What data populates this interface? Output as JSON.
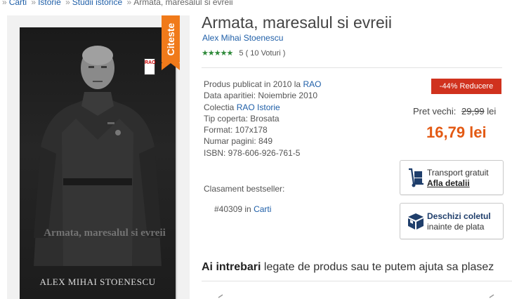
{
  "breadcrumb": {
    "items": [
      "Carti",
      "Istorie",
      "Studii istorice",
      "Armata, maresalul si evreii"
    ]
  },
  "cover": {
    "ribbon_label": "Citeste",
    "author_text": "ALEX MIHAI STOENESCU",
    "overlay_title": "Armata, maresalul si evreii",
    "publisher_mark": "RAO"
  },
  "product": {
    "title": "Armata, maresalul si evreii",
    "author": "Alex Mihai Stoenescu",
    "rating_stars": 5,
    "rating_value": "5",
    "rating_votes": "( 10 Voturi )"
  },
  "details": {
    "published_prefix": "Produs publicat in 2010 la ",
    "publisher": "RAO",
    "release_date": "Data aparitiei: Noiembrie 2010",
    "collection_prefix": "Colectia ",
    "collection": "RAO Istorie",
    "cover_type": "Tip coperta: Brosata",
    "format": "Format: 107x178",
    "pages": "Numar pagini: 849",
    "isbn": "ISBN: 978-606-926-761-5"
  },
  "bestseller": {
    "label": "Clasament bestseller:",
    "rank": "#40309 in ",
    "category": "Carti"
  },
  "price": {
    "discount_badge": "-44% Reducere",
    "old_label": "Pret vechi:",
    "old_value": "29,99",
    "old_currency": "lei",
    "new_value": "16,79 lei"
  },
  "transport_box": {
    "line1": "Transport gratuit",
    "line2": "Afla detalii"
  },
  "open_box": {
    "line1": "Deschizi coletul",
    "line2": "inainte de plata"
  },
  "questions": {
    "bold": "Ai intrebari",
    "rest": " legate de produs sau te putem ajuta sa plasez"
  },
  "colors": {
    "accent_orange": "#e35a14",
    "ribbon": "#f07a1a",
    "discount_red": "#d0321e",
    "link_blue": "#1f5fa8",
    "star_green": "#2f8a3a"
  }
}
